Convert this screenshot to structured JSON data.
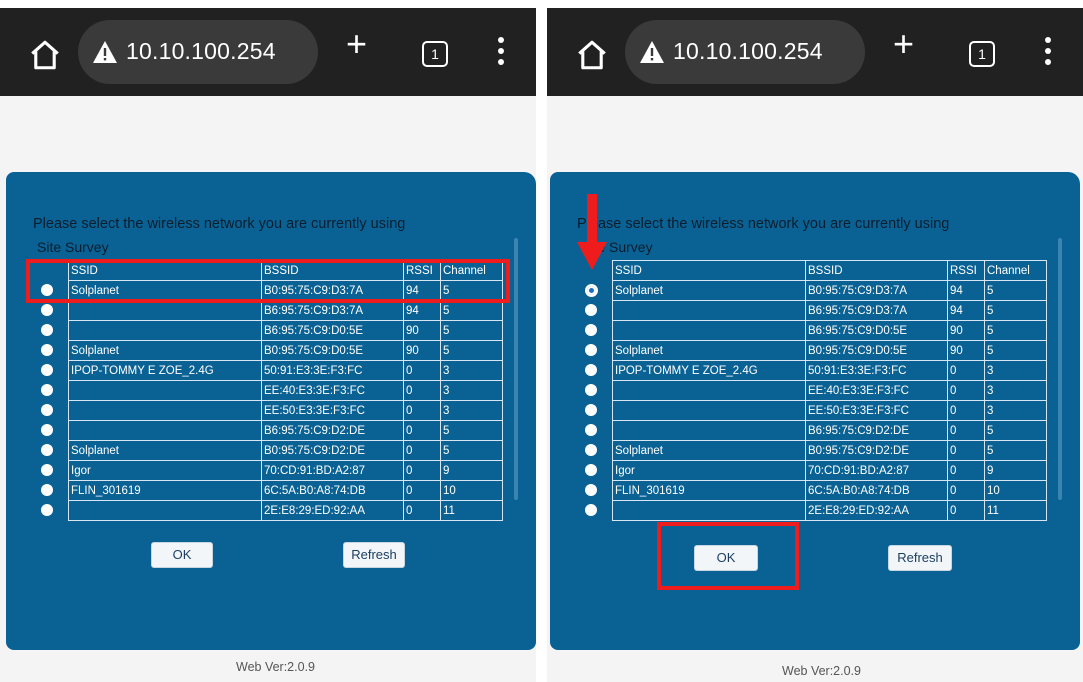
{
  "browser": {
    "url": "10.10.100.254",
    "tab_count": "1"
  },
  "dialog": {
    "prompt": "Please select the wireless network you are currently using",
    "survey_title": "Site Survey",
    "columns": [
      "SSID",
      "BSSID",
      "RSSI",
      "Channel"
    ],
    "rows": [
      {
        "ssid": "Solplanet",
        "bssid": "B0:95:75:C9:D3:7A",
        "rssi": "94",
        "channel": "5"
      },
      {
        "ssid": "",
        "bssid": "B6:95:75:C9:D3:7A",
        "rssi": "94",
        "channel": "5"
      },
      {
        "ssid": "",
        "bssid": "B6:95:75:C9:D0:5E",
        "rssi": "90",
        "channel": "5"
      },
      {
        "ssid": "Solplanet",
        "bssid": "B0:95:75:C9:D0:5E",
        "rssi": "90",
        "channel": "5"
      },
      {
        "ssid": "IPOP-TOMMY E ZOE_2.4G",
        "bssid": "50:91:E3:3E:F3:FC",
        "rssi": "0",
        "channel": "3"
      },
      {
        "ssid": "",
        "bssid": "EE:40:E3:3E:F3:FC",
        "rssi": "0",
        "channel": "3"
      },
      {
        "ssid": "",
        "bssid": "EE:50:E3:3E:F3:FC",
        "rssi": "0",
        "channel": "3"
      },
      {
        "ssid": "",
        "bssid": "B6:95:75:C9:D2:DE",
        "rssi": "0",
        "channel": "5"
      },
      {
        "ssid": "Solplanet",
        "bssid": "B0:95:75:C9:D2:DE",
        "rssi": "0",
        "channel": "5"
      },
      {
        "ssid": "Igor",
        "bssid": "70:CD:91:BD:A2:87",
        "rssi": "0",
        "channel": "9"
      },
      {
        "ssid": "FLIN_301619",
        "bssid": "6C:5A:B0:A8:74:DB",
        "rssi": "0",
        "channel": "10"
      },
      {
        "ssid": "",
        "bssid": "2E:E8:29:ED:92:AA",
        "rssi": "0",
        "channel": "11"
      }
    ],
    "ok_label": "OK",
    "refresh_label": "Refresh"
  },
  "footer": {
    "version": "Web Ver:2.0.9"
  },
  "panels": [
    {
      "name": "left",
      "selected_row": null
    },
    {
      "name": "right",
      "selected_row": 0
    }
  ],
  "colors": {
    "dialog_bg": "#0a6294",
    "highlight": "#ee1c1c",
    "toolbar": "#212121"
  }
}
